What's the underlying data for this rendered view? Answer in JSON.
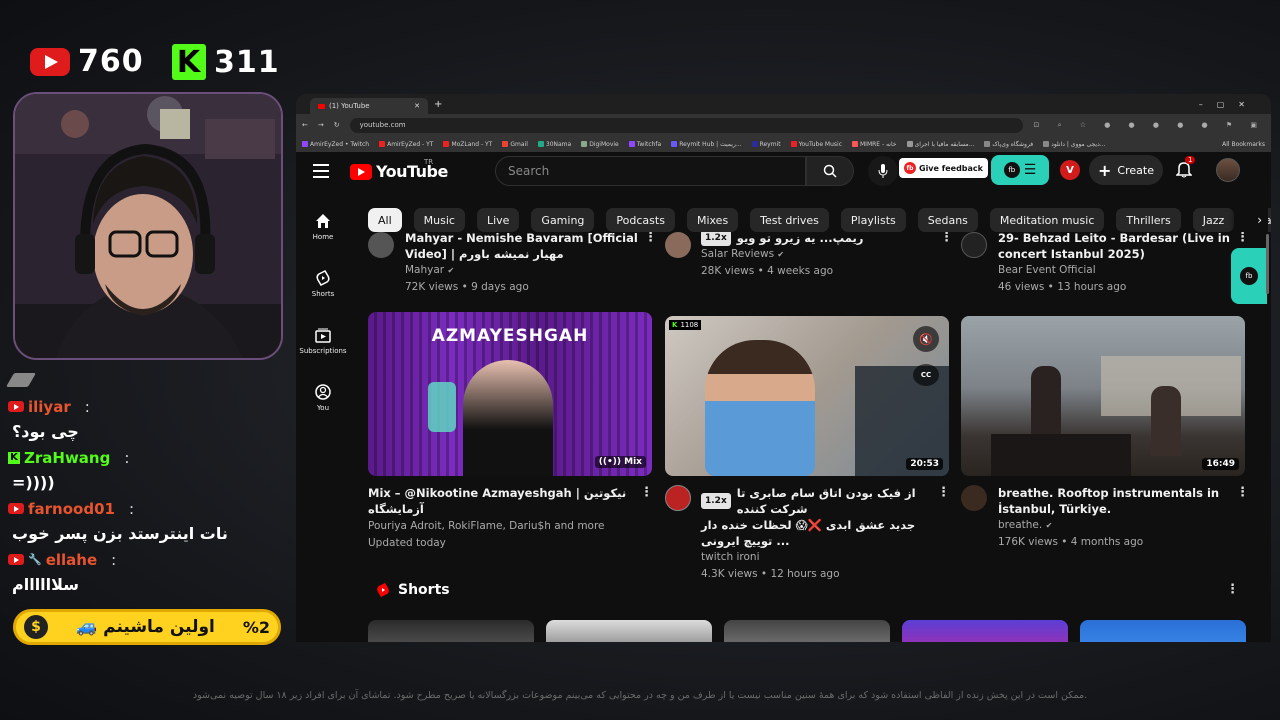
{
  "stream": {
    "youtube_viewers": "760",
    "kick_viewers": "311",
    "promo_text": "اولین ماشینم",
    "promo_percent": "%2",
    "notice": "ممکن است در این پخش زنده از الفاظی استفاده شود که برای همهٔ سنین مناسب نیست یا از طرف من و چه در محتوایی که می‌بینم موضوعات بزرگسالانه یا صریح مطرح شود. تماشای آن برای افراد زیر ۱۸ سال توصیه نمی‌شود."
  },
  "chat": [
    {
      "platform": "youtube",
      "user": "iliyar",
      "color": "#e8542e",
      "message": "چی بود؟"
    },
    {
      "platform": "kick",
      "user": "ZraHwang",
      "color": "#53fc18",
      "message": "=))))"
    },
    {
      "platform": "youtube",
      "user": "farnood01",
      "color": "#e8542e",
      "message": "نات اینترستد بزن پسر خوب"
    },
    {
      "platform": "youtube",
      "user": "ellahe",
      "color": "#e8542e",
      "message": "سلاااااام"
    }
  ],
  "browser": {
    "tab_title": "(1) YouTube",
    "url": "youtube.com",
    "all_bookmarks": "All Bookmarks",
    "bookmarks": [
      "AmirEyZed • Twitch",
      "AmirEyZed - YT",
      "MoZLand - YT",
      "Gmail",
      "30Nama",
      "DigiMovie",
      "Twitchfa",
      "Reymit Hub | ریمیت...",
      "Reymit",
      "YouTube Music",
      "MIMRE - خانه",
      "مسابقه مافیا با اجرای...",
      "فروشگاه وی‌پاک",
      "دیجی مووی | دانلود..."
    ]
  },
  "youtube": {
    "logo_text": "YouTube",
    "logo_region": "TR",
    "search_placeholder": "Search",
    "feedback_label": "Give feedback",
    "create_label": "Create",
    "notification_count": "1",
    "chips": [
      "All",
      "Music",
      "Live",
      "Gaming",
      "Podcasts",
      "Mixes",
      "Test drives",
      "Playlists",
      "Sedans",
      "Meditation music",
      "Thrillers",
      "Jazz",
      "Gadgets",
      "Ra"
    ],
    "sidebar": [
      "Home",
      "Shorts",
      "Subscriptions",
      "You"
    ],
    "row1": [
      {
        "title_l1": "Mahyar - Nemishe Bavaram [Official",
        "title_l2": "Video] | مهیار نمیشه باورم",
        "channel": "Mahyar",
        "meta": "72K views • 9 days ago"
      },
      {
        "title_l1": "ریمپ... یه زیرو تو ویو",
        "badge": "1.2x",
        "channel": "Salar Reviews",
        "meta": "28K views • 4 weeks ago"
      },
      {
        "title_l1": "29- Behzad Leito - Bardesar (Live in",
        "title_l2": "concert Istanbul 2025)",
        "channel": "Bear Event Official",
        "meta": "46 views • 13 hours ago"
      }
    ],
    "row2": [
      {
        "title_l1": "Mix – @Nikootine  Azmayeshgah | نیکوتین آزمایشگاه",
        "channel": "Pouriya Adroit, RokiFlame, Dariu$h and more",
        "meta": "Updated today",
        "thumb_text": "AZMAYESHGAH",
        "mix_label": "Mix"
      },
      {
        "title_l1": "از فیک بودن اتاق سام صابری تا شرکت کننده",
        "title_l2": "جدید عشق ابدی ❌😱 لحظات خنده دار توییچ ایرونی ...",
        "badge": "1.2x",
        "channel": "twitch ironi",
        "meta": "4.3K views • 12 hours ago",
        "duration": "20:53",
        "kick_count": "1108"
      },
      {
        "title_l1": "breathe. Rooftop instrumentals in",
        "title_l2": "İstanbul, Türkiye.",
        "channel": "breathe.",
        "meta": "176K views • 4 months ago",
        "duration": "16:49"
      }
    ],
    "shorts_label": "Shorts"
  }
}
